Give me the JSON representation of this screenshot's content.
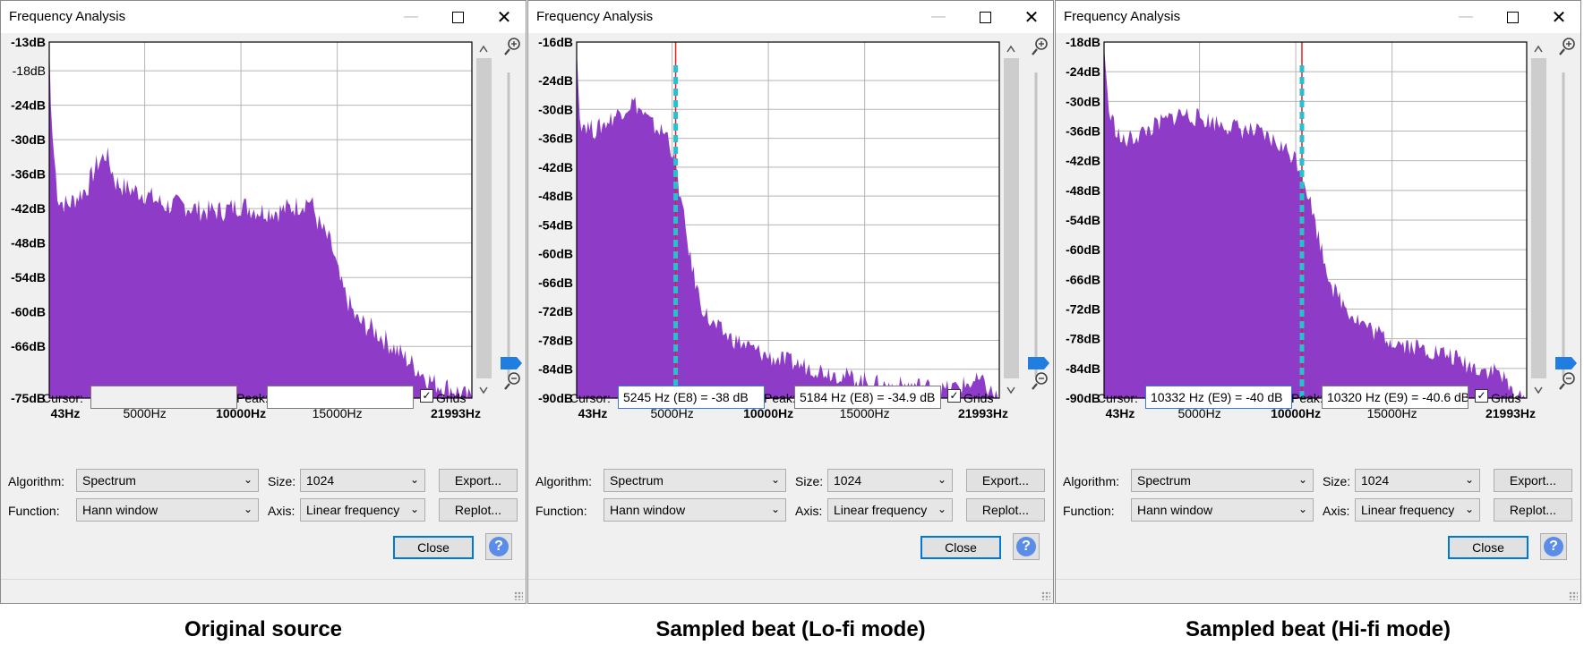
{
  "colors": {
    "spectrum_fill": "#8e3cc8",
    "cursor_line": "#e82020",
    "peak_marker": "#26c0d0",
    "default_button_border": "#0078d7"
  },
  "windows": [
    {
      "title": "Frequency Analysis",
      "controls": {
        "minimize": "—",
        "maximize": "☐",
        "close": "✕"
      },
      "y_ticks": [
        "-13dB",
        "-18dB",
        "-24dB",
        "-30dB",
        "-36dB",
        "-42dB",
        "-48dB",
        "-54dB",
        "-60dB",
        "-66dB",
        "-75dB"
      ],
      "x_ticks": [
        "43Hz",
        "5000Hz",
        "10000Hz",
        "15000Hz",
        "21993Hz"
      ],
      "cursor_label": "Cursor:",
      "cursor_value": "",
      "peak_label": "Peak:",
      "peak_value": "",
      "grids_label": "Grids",
      "grids_checked": true,
      "algorithm_label": "Algorithm:",
      "algorithm_value": "Spectrum",
      "size_label": "Size:",
      "size_value": "1024",
      "function_label": "Function:",
      "function_value": "Hann window",
      "axis_label": "Axis:",
      "axis_value": "Linear frequency",
      "export_label": "Export...",
      "replot_label": "Replot...",
      "close_label": "Close",
      "help_label": "?",
      "caption": "Original source",
      "chart_data": {
        "type": "area",
        "x_range_hz": [
          43,
          21993
        ],
        "y_range_db": [
          -75,
          -13
        ],
        "cursor_hz": null,
        "points": [
          [
            43,
            -13
          ],
          [
            150,
            -27
          ],
          [
            500,
            -40
          ],
          [
            1000,
            -41
          ],
          [
            2000,
            -38
          ],
          [
            2500,
            -34
          ],
          [
            3000,
            -32
          ],
          [
            3500,
            -37
          ],
          [
            4000,
            -38
          ],
          [
            5000,
            -39
          ],
          [
            6000,
            -41
          ],
          [
            7000,
            -41
          ],
          [
            8000,
            -42
          ],
          [
            9000,
            -42
          ],
          [
            10000,
            -41
          ],
          [
            11000,
            -42
          ],
          [
            12000,
            -42
          ],
          [
            13000,
            -41
          ],
          [
            13600,
            -40
          ],
          [
            14000,
            -44
          ],
          [
            14700,
            -48
          ],
          [
            15200,
            -55
          ],
          [
            16000,
            -61
          ],
          [
            17000,
            -63
          ],
          [
            18000,
            -66
          ],
          [
            19000,
            -69
          ],
          [
            20000,
            -72
          ],
          [
            21000,
            -73
          ],
          [
            21993,
            -75
          ]
        ]
      }
    },
    {
      "title": "Frequency Analysis",
      "controls": {
        "minimize": "—",
        "maximize": "☐",
        "close": "✕"
      },
      "y_ticks": [
        "-16dB",
        "-24dB",
        "-30dB",
        "-36dB",
        "-42dB",
        "-48dB",
        "-54dB",
        "-60dB",
        "-66dB",
        "-72dB",
        "-78dB",
        "-84dB",
        "-90dB"
      ],
      "x_ticks": [
        "43Hz",
        "5000Hz",
        "10000Hz",
        "15000Hz",
        "21993Hz"
      ],
      "cursor_label": "Cursor:",
      "cursor_value": "5245 Hz (E8) = -38 dB",
      "peak_label": "Peak:",
      "peak_value": "5184 Hz (E8) = -34.9 dB",
      "grids_label": "Grids",
      "grids_checked": true,
      "algorithm_label": "Algorithm:",
      "algorithm_value": "Spectrum",
      "size_label": "Size:",
      "size_value": "1024",
      "function_label": "Function:",
      "function_value": "Hann window",
      "axis_label": "Axis:",
      "axis_value": "Linear frequency",
      "export_label": "Export...",
      "replot_label": "Replot...",
      "close_label": "Close",
      "help_label": "?",
      "caption": "Sampled beat (Lo-fi mode)",
      "chart_data": {
        "type": "area",
        "x_range_hz": [
          43,
          21993
        ],
        "y_range_db": [
          -90,
          -16
        ],
        "cursor_hz": 5184,
        "points": [
          [
            43,
            -17
          ],
          [
            200,
            -32
          ],
          [
            1000,
            -34
          ],
          [
            2000,
            -31
          ],
          [
            3000,
            -28
          ],
          [
            4000,
            -33
          ],
          [
            4800,
            -35
          ],
          [
            5200,
            -42
          ],
          [
            5600,
            -52
          ],
          [
            6000,
            -62
          ],
          [
            6500,
            -70
          ],
          [
            7000,
            -74
          ],
          [
            8000,
            -77
          ],
          [
            9000,
            -79
          ],
          [
            10000,
            -81
          ],
          [
            11000,
            -82
          ],
          [
            12000,
            -83
          ],
          [
            13000,
            -84
          ],
          [
            14000,
            -85
          ],
          [
            15000,
            -86
          ],
          [
            16000,
            -87
          ],
          [
            17000,
            -87
          ],
          [
            18000,
            -87
          ],
          [
            19000,
            -88
          ],
          [
            20000,
            -87
          ],
          [
            21000,
            -86
          ],
          [
            21993,
            -90
          ]
        ]
      }
    },
    {
      "title": "Frequency Analysis",
      "controls": {
        "minimize": "—",
        "maximize": "☐",
        "close": "✕"
      },
      "y_ticks": [
        "-18dB",
        "-24dB",
        "-30dB",
        "-36dB",
        "-42dB",
        "-48dB",
        "-54dB",
        "-60dB",
        "-66dB",
        "-72dB",
        "-78dB",
        "-84dB",
        "-90dB"
      ],
      "x_ticks": [
        "43Hz",
        "5000Hz",
        "10000Hz",
        "15000Hz",
        "21993Hz"
      ],
      "cursor_label": "Cursor:",
      "cursor_value": "10332 Hz (E9) = -40 dB",
      "peak_label": "Peak:",
      "peak_value": "10320 Hz (E9) = -40.6 dB",
      "grids_label": "Grids",
      "grids_checked": true,
      "algorithm_label": "Algorithm:",
      "algorithm_value": "Spectrum",
      "size_label": "Size:",
      "size_value": "1024",
      "function_label": "Function:",
      "function_value": "Hann window",
      "axis_label": "Axis:",
      "axis_value": "Linear frequency",
      "export_label": "Export...",
      "replot_label": "Replot...",
      "close_label": "Close",
      "help_label": "?",
      "caption": "Sampled beat (Hi-fi mode)",
      "chart_data": {
        "type": "area",
        "x_range_hz": [
          43,
          21993
        ],
        "y_range_db": [
          -90,
          -18
        ],
        "cursor_hz": 10320,
        "points": [
          [
            43,
            -19
          ],
          [
            300,
            -32
          ],
          [
            1000,
            -38
          ],
          [
            2000,
            -36
          ],
          [
            3000,
            -34
          ],
          [
            4000,
            -32
          ],
          [
            5000,
            -33
          ],
          [
            6000,
            -34
          ],
          [
            7000,
            -35
          ],
          [
            8000,
            -36
          ],
          [
            9000,
            -38
          ],
          [
            10000,
            -41
          ],
          [
            10500,
            -46
          ],
          [
            11000,
            -54
          ],
          [
            11500,
            -62
          ],
          [
            12000,
            -68
          ],
          [
            13000,
            -73
          ],
          [
            14000,
            -76
          ],
          [
            15000,
            -78
          ],
          [
            16000,
            -79
          ],
          [
            17000,
            -80
          ],
          [
            18000,
            -81
          ],
          [
            19000,
            -83
          ],
          [
            20000,
            -84
          ],
          [
            20500,
            -84
          ],
          [
            21000,
            -87
          ],
          [
            21500,
            -90
          ],
          [
            21993,
            -90
          ]
        ]
      }
    }
  ]
}
